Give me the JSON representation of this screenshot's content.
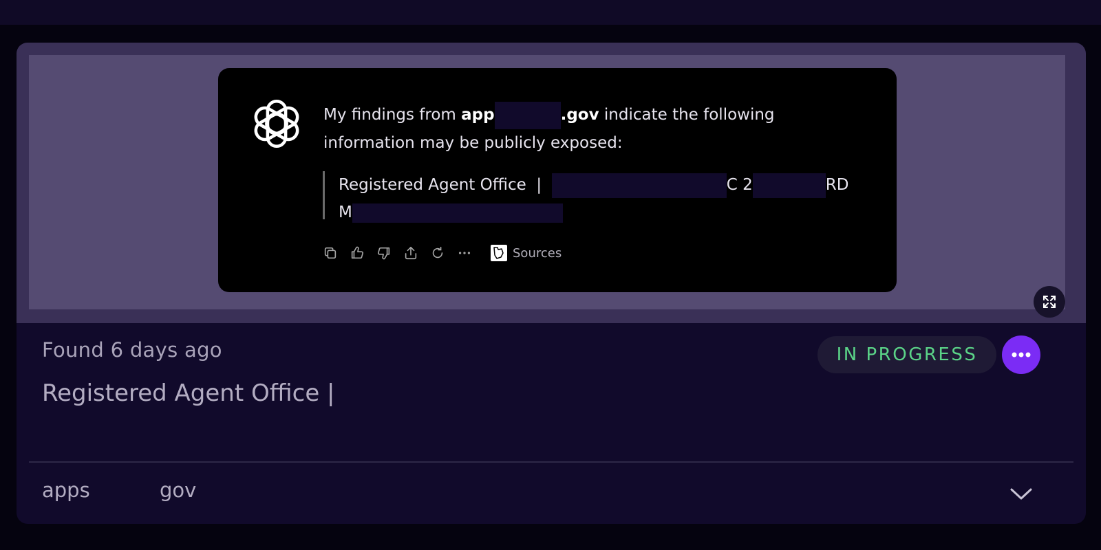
{
  "preview": {
    "message_lead": "My findings from ",
    "message_domain_a": "app",
    "message_domain_b": ".gov",
    "message_tail": " indicate the following information may be publicly exposed:",
    "quote_label": "Registered Agent Office",
    "quote_sep": "|",
    "quote_frag_1": "C 2",
    "quote_frag_2": "RD",
    "quote_frag_3": "M",
    "sources_label": "Sources"
  },
  "finding": {
    "found_text": "Found 6 days ago",
    "title": "Registered Agent Office |",
    "status": "IN PROGRESS"
  },
  "tags": [
    "apps",
    "gov"
  ],
  "colors": {
    "status_text": "#5bd488",
    "accent": "#7b2cf5",
    "card_bg": "#110a2b"
  },
  "icons": {
    "logo": "openai-logo",
    "actions": [
      "copy-icon",
      "thumbs-up-icon",
      "thumbs-down-icon",
      "share-icon",
      "regenerate-icon",
      "more-horizontal-icon"
    ],
    "expand": "expand-icon",
    "more": "more-icon",
    "chevron": "chevron-down-icon"
  }
}
